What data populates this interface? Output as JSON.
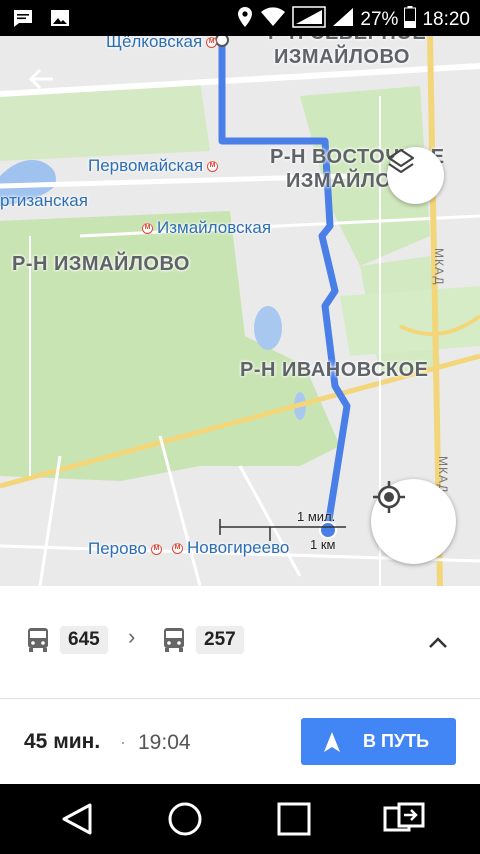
{
  "status_bar": {
    "battery_percent": "27%",
    "time": "18:20",
    "left_icons": [
      "message-icon",
      "image-icon"
    ],
    "right_icons": [
      "location-icon",
      "wifi-icon",
      "signal-icon",
      "signal-icon",
      "battery-icon"
    ]
  },
  "map": {
    "districts": {
      "severnoe_line1": "Р-Н СЕВЕРНОЕ",
      "severnoe_line2": "ИЗМАЙЛОВО",
      "vostochnoe_line1": "Р-Н ВОСТОЧНОЕ",
      "vostochnoe_line2": "ИЗМАЙЛОВО",
      "izmailovo": "Р-Н ИЗМАЙЛОВО",
      "ivanovskoe": "Р-Н ИВАНОВСКОЕ"
    },
    "metro": {
      "shchelkovskaya": "Щёлковская",
      "pervomaiskaya": "Первомайская",
      "partizanskaya": "ртизанская",
      "izmailovskaya": "Измайловская",
      "perovo": "Перово",
      "novogireevo": "Новогиреево"
    },
    "road_label": "МКАД",
    "scale": {
      "miles": "1 мил.",
      "km": "1 км"
    },
    "colors": {
      "route": "#4a7fe8",
      "park": "#c8e6b0",
      "water": "#a8c8f0"
    }
  },
  "route": {
    "segments": [
      {
        "mode": "bus-icon",
        "number": "645"
      },
      {
        "mode": "bus-icon",
        "number": "257"
      }
    ],
    "duration": "45 мин.",
    "separator": "·",
    "arrival": "19:04",
    "go_label": "В ПУТЬ"
  },
  "nav_bar": {
    "buttons": [
      "back-triangle-icon",
      "home-circle-icon",
      "recents-square-icon",
      "screen-switch-icon"
    ]
  }
}
